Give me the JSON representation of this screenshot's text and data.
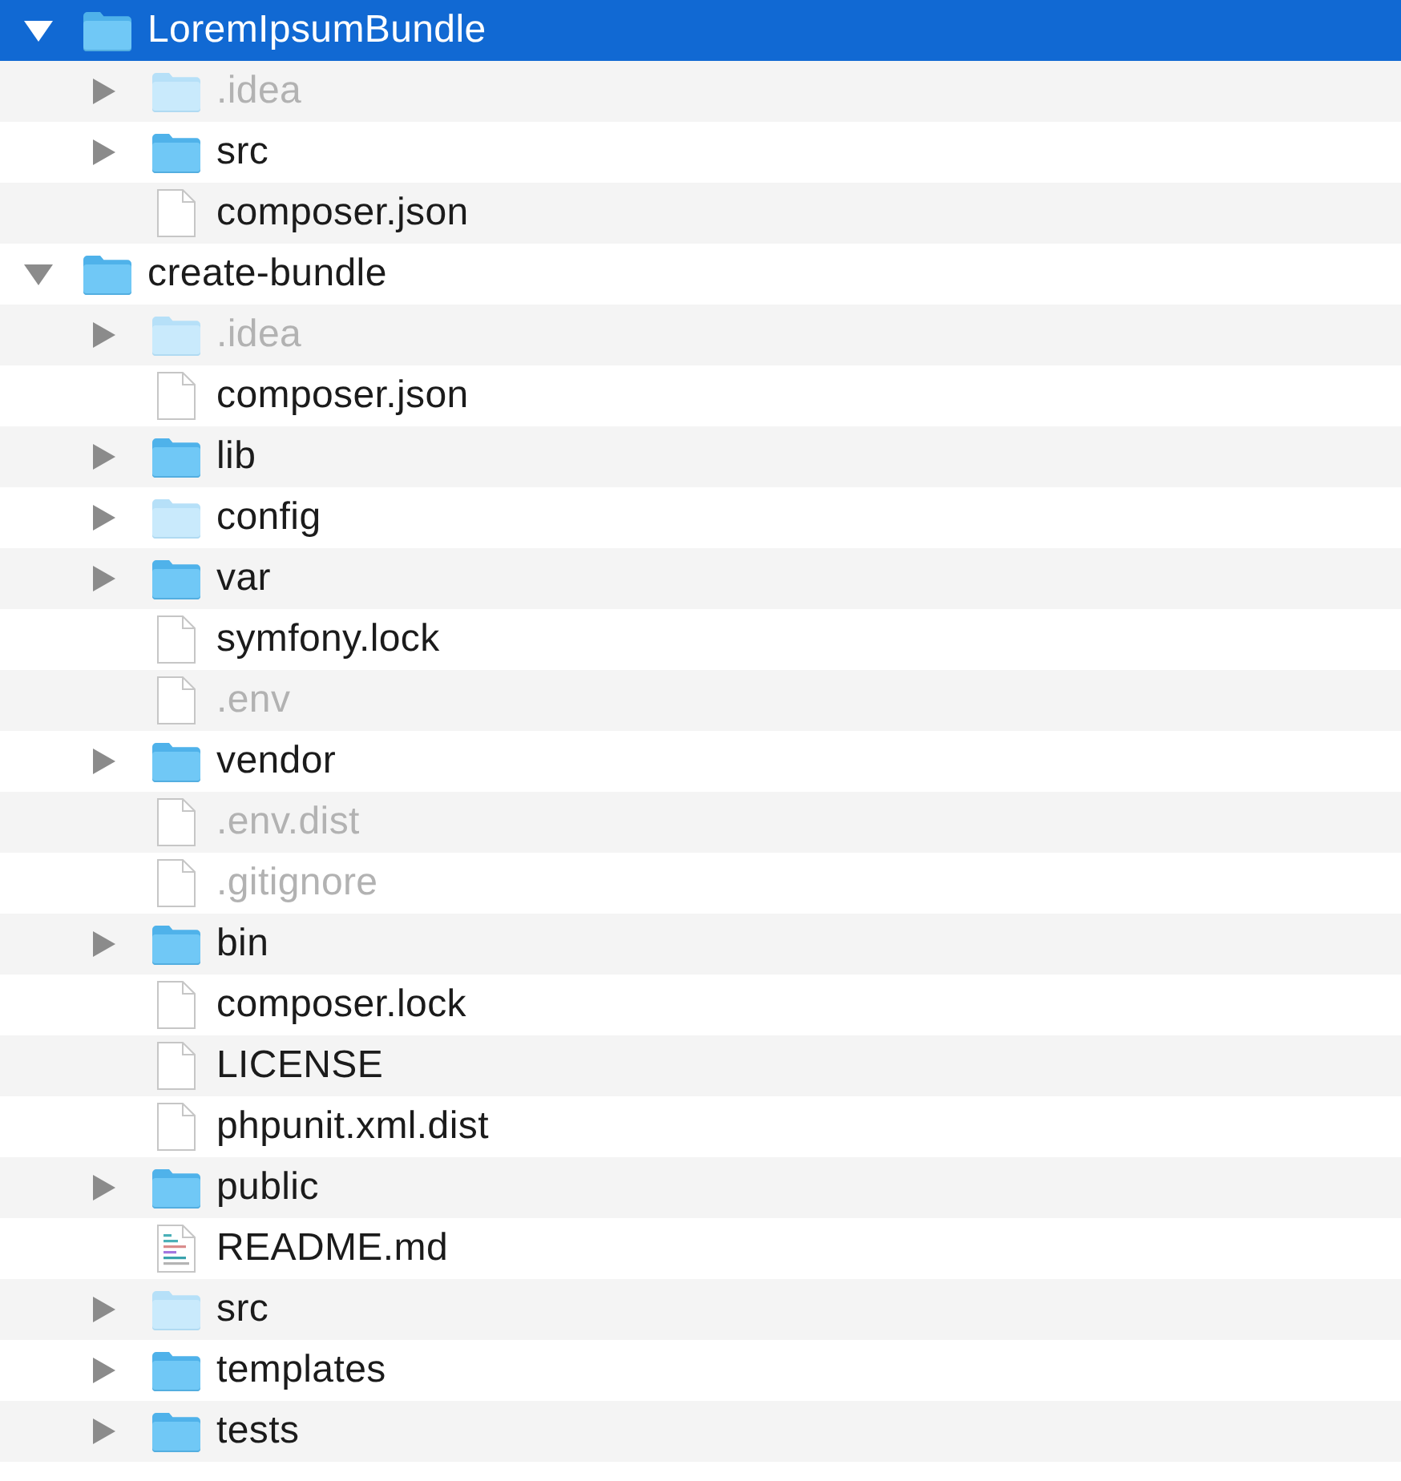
{
  "tree": [
    {
      "name": "LoremIpsumBundle",
      "kind": "folder",
      "expanded": true,
      "selected": true,
      "dimmed": false,
      "faded_icon": false,
      "children": [
        {
          "name": ".idea",
          "kind": "folder",
          "expanded": false,
          "selected": false,
          "dimmed": true,
          "faded_icon": true
        },
        {
          "name": "src",
          "kind": "folder",
          "expanded": false,
          "selected": false,
          "dimmed": false,
          "faded_icon": false
        },
        {
          "name": "composer.json",
          "kind": "file",
          "selected": false,
          "dimmed": false,
          "faded_icon": false
        }
      ]
    },
    {
      "name": "create-bundle",
      "kind": "folder",
      "expanded": true,
      "selected": false,
      "dimmed": false,
      "faded_icon": false,
      "children": [
        {
          "name": ".idea",
          "kind": "folder",
          "expanded": false,
          "selected": false,
          "dimmed": true,
          "faded_icon": true
        },
        {
          "name": "composer.json",
          "kind": "file",
          "selected": false,
          "dimmed": false,
          "faded_icon": false
        },
        {
          "name": "lib",
          "kind": "folder",
          "expanded": false,
          "selected": false,
          "dimmed": false,
          "faded_icon": false
        },
        {
          "name": "config",
          "kind": "folder",
          "expanded": false,
          "selected": false,
          "dimmed": false,
          "faded_icon": true
        },
        {
          "name": "var",
          "kind": "folder",
          "expanded": false,
          "selected": false,
          "dimmed": false,
          "faded_icon": false
        },
        {
          "name": "symfony.lock",
          "kind": "file",
          "selected": false,
          "dimmed": false,
          "faded_icon": false
        },
        {
          "name": ".env",
          "kind": "file",
          "selected": false,
          "dimmed": true,
          "faded_icon": false
        },
        {
          "name": "vendor",
          "kind": "folder",
          "expanded": false,
          "selected": false,
          "dimmed": false,
          "faded_icon": false
        },
        {
          "name": ".env.dist",
          "kind": "file",
          "selected": false,
          "dimmed": true,
          "faded_icon": false
        },
        {
          "name": ".gitignore",
          "kind": "file",
          "selected": false,
          "dimmed": true,
          "faded_icon": false
        },
        {
          "name": "bin",
          "kind": "folder",
          "expanded": false,
          "selected": false,
          "dimmed": false,
          "faded_icon": false
        },
        {
          "name": "composer.lock",
          "kind": "file",
          "selected": false,
          "dimmed": false,
          "faded_icon": false
        },
        {
          "name": "LICENSE",
          "kind": "file",
          "selected": false,
          "dimmed": false,
          "faded_icon": false
        },
        {
          "name": "phpunit.xml.dist",
          "kind": "file",
          "selected": false,
          "dimmed": false,
          "faded_icon": false
        },
        {
          "name": "public",
          "kind": "folder",
          "expanded": false,
          "selected": false,
          "dimmed": false,
          "faded_icon": false
        },
        {
          "name": "README.md",
          "kind": "document",
          "selected": false,
          "dimmed": false,
          "faded_icon": false
        },
        {
          "name": "src",
          "kind": "folder",
          "expanded": false,
          "selected": false,
          "dimmed": false,
          "faded_icon": true
        },
        {
          "name": "templates",
          "kind": "folder",
          "expanded": false,
          "selected": false,
          "dimmed": false,
          "faded_icon": false
        },
        {
          "name": "tests",
          "kind": "folder",
          "expanded": false,
          "selected": false,
          "dimmed": false,
          "faded_icon": false
        }
      ]
    }
  ]
}
